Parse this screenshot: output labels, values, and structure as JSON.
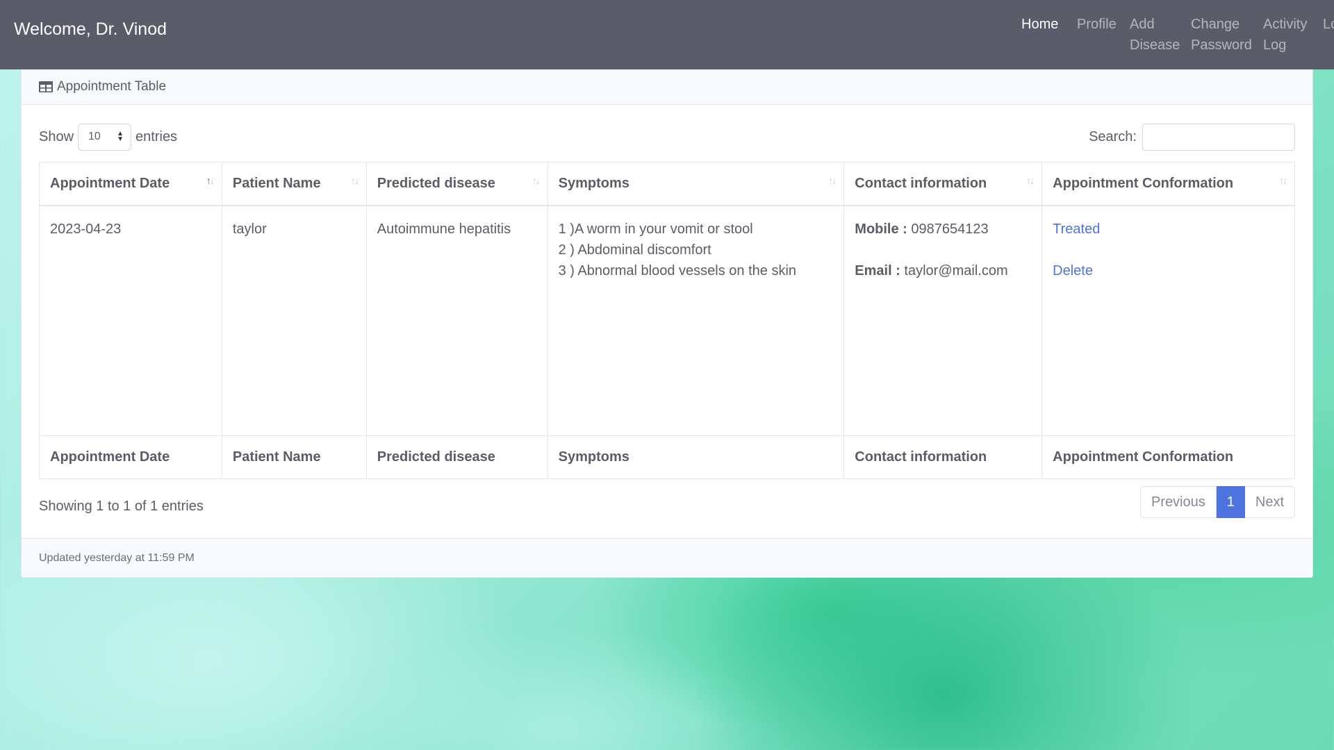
{
  "navbar": {
    "brand": "Welcome, Dr. Vinod",
    "items": [
      {
        "label": "Home"
      },
      {
        "label": "Profile"
      },
      {
        "label": "Add Disease"
      },
      {
        "label": "Change Password"
      },
      {
        "label": "Activity Log"
      },
      {
        "label": "Logout"
      }
    ]
  },
  "card": {
    "title": "Appointment Table",
    "footer": "Updated yesterday at 11:59 PM"
  },
  "controls": {
    "show_label": "Show",
    "entries_label": "entries",
    "page_length": "10",
    "search_label": "Search:",
    "search_value": ""
  },
  "table": {
    "columns": [
      "Appointment Date",
      "Patient Name",
      "Predicted disease",
      "Symptoms",
      "Contact information",
      "Appointment Conformation"
    ],
    "rows": [
      {
        "date": "2023-04-23",
        "patient": "taylor",
        "disease": "Autoimmune hepatitis",
        "symptoms": [
          "1 )A worm in your vomit or stool",
          "2 ) Abdominal discomfort",
          "3 ) Abnormal blood vessels on the skin"
        ],
        "mobile_label": "Mobile :",
        "mobile": "0987654123",
        "email_label": "Email :",
        "email": "taylor@mail.com",
        "actions": {
          "treated": "Treated",
          "delete": "Delete"
        }
      }
    ]
  },
  "info": "Showing 1 to 1 of 1 entries",
  "pagination": {
    "previous": "Previous",
    "current": "1",
    "next": "Next"
  },
  "colors": {
    "navbar": "#5a5c69",
    "accent": "#4e73df"
  }
}
